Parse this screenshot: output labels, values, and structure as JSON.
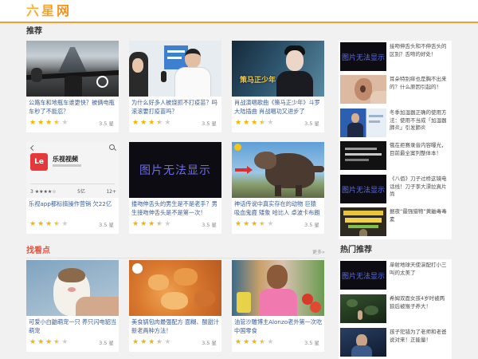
{
  "header": {
    "logo": "六星网"
  },
  "colors": {
    "accent": "#f0a030",
    "highlight": "#e5533d",
    "star": "#f5b400",
    "link": "#3b5d9b"
  },
  "recommend": {
    "title": "推荐",
    "cards": [
      {
        "title": "公路车和地瓶车谁更快？被俩电瓶车秒了不能忍？",
        "rating": 3.5,
        "rating_label": "3.5 星"
      },
      {
        "title": "为什么好多人被烧抓不打疫苗？吗滚滚要打疫苗吗？",
        "rating": 3.5,
        "rating_label": "3.5 星"
      },
      {
        "title": "肖战演唱歌曲《策马正少年》斗罗大陆插曲 肖战唱功又进步了",
        "rating": 3.5,
        "rating_label": "3.5 星",
        "thumb_text": "策马正少年"
      },
      {
        "title": "乐视app都标搞操作营销 欠22亿",
        "rating": 3.5,
        "rating_label": "3.5 星",
        "thumb_app": {
          "logo": "Le",
          "name": "乐视视频",
          "score": "3 ★★★★☆",
          "installs": "5亿",
          "age": "12+"
        }
      },
      {
        "title": "搂吻伸舌头的男生是不是老手？男生接吻伸舌头是不是第一次！",
        "rating": 3.5,
        "rating_label": "3.5 星",
        "thumb_text": "图片无法显示"
      },
      {
        "title": "神话传说中真实存在的动物 巨猿 吸血鬼鹿 矮象 哈比人 卓波卡布朗",
        "rating": 3.5,
        "rating_label": "3.5 星"
      }
    ]
  },
  "highlights": {
    "title": "找看点",
    "more": "更多»",
    "cards": [
      {
        "title": "可爱小白鼬萌宠一只 养只闪电貂当萌宠",
        "rating": 3.5,
        "rating_label": "3.5 星"
      },
      {
        "title": "美食锅包肉最强配方 面糊、酸甜汁 新老两种方法！",
        "rating": 3.5,
        "rating_label": "3.5 星"
      },
      {
        "title": "油管沙雕博主Alonzo老外第一次吃中国零食",
        "rating": 3.5,
        "rating_label": "3.5 星"
      }
    ]
  },
  "sidebar": {
    "recommended": [
      {
        "title": "接吻伸舌头和不伸舌头的区别？舌吻的好处！",
        "thumb_text": "图片无法显示"
      },
      {
        "title": "耳朵特别痒也是胸不出来的？什么原因引起的！"
      },
      {
        "title": "冬季加湿器正确的使用方法：使用不当成「加湿器肺炎」引发肺炎"
      },
      {
        "title": "俄在拒赛录音内容曝光，目前最全案列整体本！"
      },
      {
        "title": "《八佰》刀子过桥这镜电话线！刀子李大漂拉真片尚",
        "thumb_text": "图片无法显示"
      },
      {
        "title": "据夜“最强猎物”黄鼬毒毒素"
      }
    ],
    "hot": {
      "title": "热门推荐",
      "items": [
        {
          "title": "单射地球天使演配打小三叫的太美了",
          "thumb_text": "图片无法显示"
        },
        {
          "title": "希姆双面女孩4岁时被两狼后被猴子养大！"
        },
        {
          "title": "孩子犯错为了老师和老爸说对来！正能量！"
        }
      ]
    }
  }
}
